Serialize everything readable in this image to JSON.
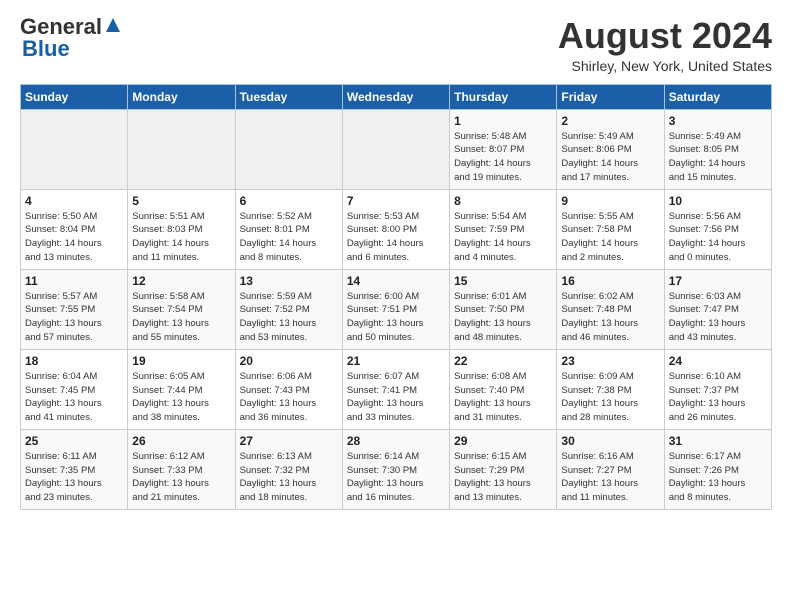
{
  "header": {
    "logo_general": "General",
    "logo_blue": "Blue",
    "month_title": "August 2024",
    "location": "Shirley, New York, United States"
  },
  "weekdays": [
    "Sunday",
    "Monday",
    "Tuesday",
    "Wednesday",
    "Thursday",
    "Friday",
    "Saturday"
  ],
  "weeks": [
    [
      {
        "day": "",
        "info": ""
      },
      {
        "day": "",
        "info": ""
      },
      {
        "day": "",
        "info": ""
      },
      {
        "day": "",
        "info": ""
      },
      {
        "day": "1",
        "info": "Sunrise: 5:48 AM\nSunset: 8:07 PM\nDaylight: 14 hours\nand 19 minutes."
      },
      {
        "day": "2",
        "info": "Sunrise: 5:49 AM\nSunset: 8:06 PM\nDaylight: 14 hours\nand 17 minutes."
      },
      {
        "day": "3",
        "info": "Sunrise: 5:49 AM\nSunset: 8:05 PM\nDaylight: 14 hours\nand 15 minutes."
      }
    ],
    [
      {
        "day": "4",
        "info": "Sunrise: 5:50 AM\nSunset: 8:04 PM\nDaylight: 14 hours\nand 13 minutes."
      },
      {
        "day": "5",
        "info": "Sunrise: 5:51 AM\nSunset: 8:03 PM\nDaylight: 14 hours\nand 11 minutes."
      },
      {
        "day": "6",
        "info": "Sunrise: 5:52 AM\nSunset: 8:01 PM\nDaylight: 14 hours\nand 8 minutes."
      },
      {
        "day": "7",
        "info": "Sunrise: 5:53 AM\nSunset: 8:00 PM\nDaylight: 14 hours\nand 6 minutes."
      },
      {
        "day": "8",
        "info": "Sunrise: 5:54 AM\nSunset: 7:59 PM\nDaylight: 14 hours\nand 4 minutes."
      },
      {
        "day": "9",
        "info": "Sunrise: 5:55 AM\nSunset: 7:58 PM\nDaylight: 14 hours\nand 2 minutes."
      },
      {
        "day": "10",
        "info": "Sunrise: 5:56 AM\nSunset: 7:56 PM\nDaylight: 14 hours\nand 0 minutes."
      }
    ],
    [
      {
        "day": "11",
        "info": "Sunrise: 5:57 AM\nSunset: 7:55 PM\nDaylight: 13 hours\nand 57 minutes."
      },
      {
        "day": "12",
        "info": "Sunrise: 5:58 AM\nSunset: 7:54 PM\nDaylight: 13 hours\nand 55 minutes."
      },
      {
        "day": "13",
        "info": "Sunrise: 5:59 AM\nSunset: 7:52 PM\nDaylight: 13 hours\nand 53 minutes."
      },
      {
        "day": "14",
        "info": "Sunrise: 6:00 AM\nSunset: 7:51 PM\nDaylight: 13 hours\nand 50 minutes."
      },
      {
        "day": "15",
        "info": "Sunrise: 6:01 AM\nSunset: 7:50 PM\nDaylight: 13 hours\nand 48 minutes."
      },
      {
        "day": "16",
        "info": "Sunrise: 6:02 AM\nSunset: 7:48 PM\nDaylight: 13 hours\nand 46 minutes."
      },
      {
        "day": "17",
        "info": "Sunrise: 6:03 AM\nSunset: 7:47 PM\nDaylight: 13 hours\nand 43 minutes."
      }
    ],
    [
      {
        "day": "18",
        "info": "Sunrise: 6:04 AM\nSunset: 7:45 PM\nDaylight: 13 hours\nand 41 minutes."
      },
      {
        "day": "19",
        "info": "Sunrise: 6:05 AM\nSunset: 7:44 PM\nDaylight: 13 hours\nand 38 minutes."
      },
      {
        "day": "20",
        "info": "Sunrise: 6:06 AM\nSunset: 7:43 PM\nDaylight: 13 hours\nand 36 minutes."
      },
      {
        "day": "21",
        "info": "Sunrise: 6:07 AM\nSunset: 7:41 PM\nDaylight: 13 hours\nand 33 minutes."
      },
      {
        "day": "22",
        "info": "Sunrise: 6:08 AM\nSunset: 7:40 PM\nDaylight: 13 hours\nand 31 minutes."
      },
      {
        "day": "23",
        "info": "Sunrise: 6:09 AM\nSunset: 7:38 PM\nDaylight: 13 hours\nand 28 minutes."
      },
      {
        "day": "24",
        "info": "Sunrise: 6:10 AM\nSunset: 7:37 PM\nDaylight: 13 hours\nand 26 minutes."
      }
    ],
    [
      {
        "day": "25",
        "info": "Sunrise: 6:11 AM\nSunset: 7:35 PM\nDaylight: 13 hours\nand 23 minutes."
      },
      {
        "day": "26",
        "info": "Sunrise: 6:12 AM\nSunset: 7:33 PM\nDaylight: 13 hours\nand 21 minutes."
      },
      {
        "day": "27",
        "info": "Sunrise: 6:13 AM\nSunset: 7:32 PM\nDaylight: 13 hours\nand 18 minutes."
      },
      {
        "day": "28",
        "info": "Sunrise: 6:14 AM\nSunset: 7:30 PM\nDaylight: 13 hours\nand 16 minutes."
      },
      {
        "day": "29",
        "info": "Sunrise: 6:15 AM\nSunset: 7:29 PM\nDaylight: 13 hours\nand 13 minutes."
      },
      {
        "day": "30",
        "info": "Sunrise: 6:16 AM\nSunset: 7:27 PM\nDaylight: 13 hours\nand 11 minutes."
      },
      {
        "day": "31",
        "info": "Sunrise: 6:17 AM\nSunset: 7:26 PM\nDaylight: 13 hours\nand 8 minutes."
      }
    ]
  ]
}
